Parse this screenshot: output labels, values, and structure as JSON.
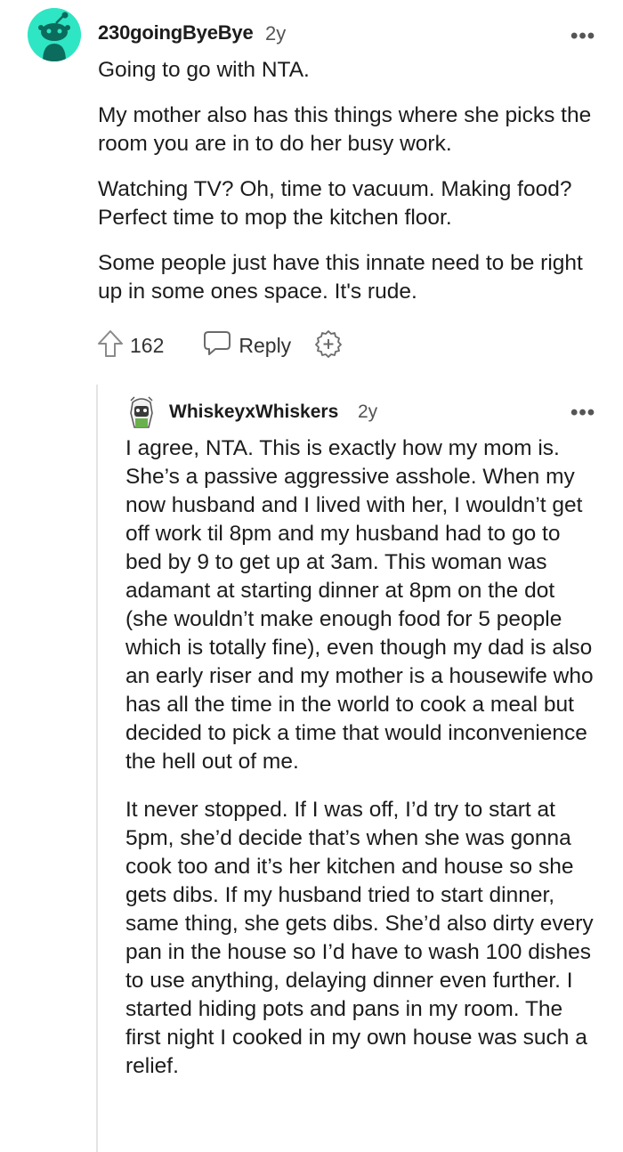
{
  "comment": {
    "username": "230goingByeBye",
    "age": "2y",
    "paragraphs": [
      "Going to go with NTA.",
      "My mother also has this things where she picks the room you are in to do her busy work.",
      "Watching TV? Oh, time to vacuum. Making food? Perfect time to mop the kitchen floor.",
      "Some people just have this innate need to be right up in some ones space. It's rude."
    ],
    "votes": "162",
    "reply_label": "Reply",
    "more_label": "•••"
  },
  "reply": {
    "username": "WhiskeyxWhiskers",
    "age": "2y",
    "more_label": "•••",
    "paragraphs": [
      "I agree, NTA. This is exactly how my mom is. She’s a passive aggressive asshole. When my now husband and I lived with her, I wouldn’t get off work til 8pm and my husband had to go to bed by 9 to get up at 3am. This woman was adamant at starting dinner at 8pm on the dot (she wouldn’t make enough food for 5 people which is totally fine), even though my dad is also an early riser and my mother is a housewife who has all the time in the world to cook a meal but decided to pick a time that would inconvenience the hell out of me.",
      "It never stopped. If I was off, I’d try to start at 5pm, she’d decide that’s when she was gonna cook too and it’s her kitchen and house so she gets dibs. If my husband tried to start dinner, same thing, she gets dibs. She’d also dirty every pan in the house so I’d have to wash 100 dishes to use anything, delaying dinner even further. I started hiding pots and pans in my room. The first night I cooked in my own house was such a relief."
    ]
  },
  "colors": {
    "avatar_bg": "#2ee6c4",
    "text": "#1c1c1c",
    "meta": "#555555",
    "thread_line": "#e4e4e4"
  },
  "icons": [
    "snoo-avatar-icon",
    "upvote-arrow-icon",
    "reply-bubble-icon",
    "award-plus-icon",
    "more-options-icon",
    "user-avatar-icon"
  ]
}
